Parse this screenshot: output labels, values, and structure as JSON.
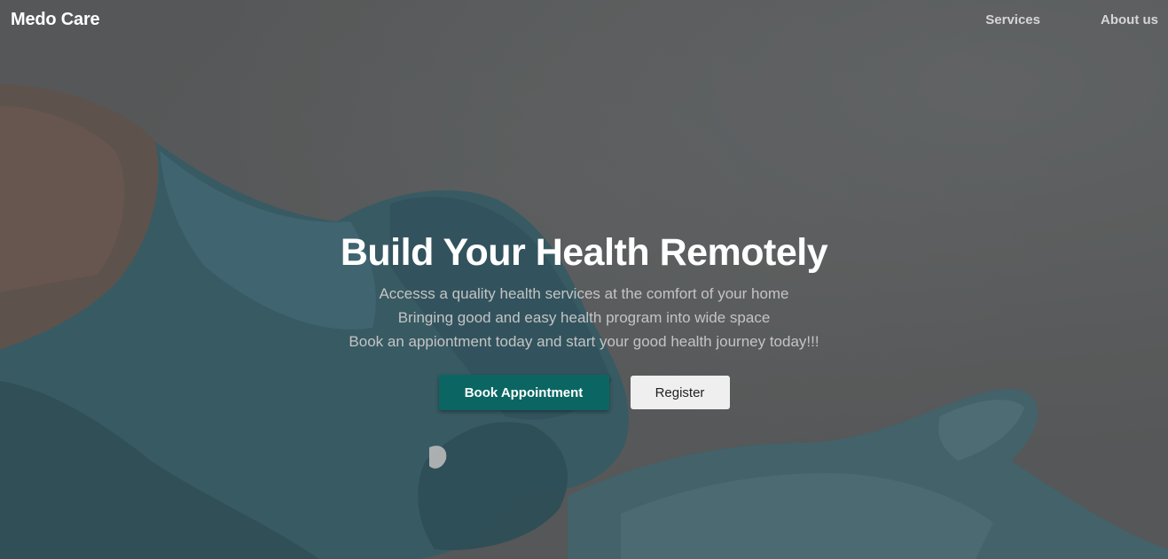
{
  "brand": {
    "name": "Medo Care"
  },
  "nav": {
    "services_label": "Services",
    "about_label": "About us"
  },
  "hero": {
    "title": "Build Your Health Remotely",
    "lines": [
      "Accesss a quality health services at the comfort of your home",
      "Bringing good and easy health program into wide space",
      "Book an appiontment today and start your good health journey today!!!"
    ],
    "book_label": "Book Appointment",
    "register_label": "Register",
    "background_icon": "gloved-hands-photo"
  },
  "colors": {
    "primary_button": "#0b6663",
    "secondary_button": "#efefef",
    "overlay": "#606162",
    "glove": "#3f6f7b",
    "skin": "#7a5a4e"
  }
}
